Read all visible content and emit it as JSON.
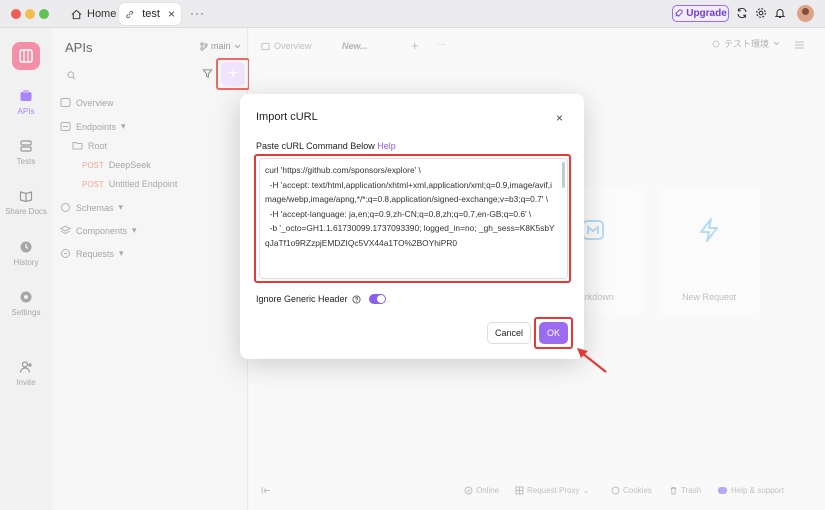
{
  "titlebar": {
    "home_tab": "Home",
    "active_tab": "test",
    "close_glyph": "×",
    "more_glyph": "···",
    "upgrade_label": "Upgrade"
  },
  "rail": {
    "items": [
      {
        "label": "APIs",
        "icon": "apis-icon"
      },
      {
        "label": "Tests",
        "icon": "tests-icon"
      },
      {
        "label": "Share Docs",
        "icon": "share-docs-icon"
      },
      {
        "label": "History",
        "icon": "history-icon"
      },
      {
        "label": "Settings",
        "icon": "settings-icon"
      },
      {
        "label": "Invite",
        "icon": "invite-icon"
      }
    ]
  },
  "sidebar": {
    "title": "APIs",
    "branch": "main",
    "add_glyph": "+",
    "overview": "Overview",
    "endpoints": "Endpoints",
    "root": "Root",
    "endpoint1_method": "POST",
    "endpoint1_name": "DeepSeek",
    "endpoint2_method": "POST",
    "endpoint2_name": "Untitled Endpoint",
    "schemas": "Schemas",
    "components": "Components",
    "requests": "Requests"
  },
  "main": {
    "tab_overview": "Overview",
    "tab_new": "New...",
    "add_glyph": "+",
    "more_glyph": "···",
    "environment": "テスト環境",
    "card_markdown": "Markdown",
    "card_new_request": "New Request",
    "status": {
      "online": "Online",
      "request_proxy": "Request Proxy",
      "cookies": "Cookies",
      "trash": "Trash",
      "help": "Help & support"
    }
  },
  "dialog": {
    "title": "Import cURL",
    "close_glyph": "×",
    "label": "Paste cURL Command Below",
    "help_link": "Help",
    "curl_text": "curl 'https://github.com/sponsors/explore' \\\n  -H 'accept: text/html,application/xhtml+xml,application/xml;q=0.9,image/avif,image/webp,image/apng,*/*;q=0.8,application/signed-exchange;v=b3;q=0.7' \\\n  -H 'accept-language: ja,en;q=0.9,zh-CN;q=0.8,zh;q=0.7,en-GB;q=0.6' \\\n  -b '_octo=GH1.1.61730099.1737093390; logged_in=no; _gh_sess=K8K5sbYqJaTf1o9RZzpjEMDZIQc5VX44a1TO%2BOYhiPR0",
    "toggle_label": "Ignore Generic Header",
    "toggle_on": true,
    "cancel_label": "Cancel",
    "ok_label": "OK"
  },
  "colors": {
    "accent": "#8b5cf6",
    "highlight": "#e53935"
  }
}
